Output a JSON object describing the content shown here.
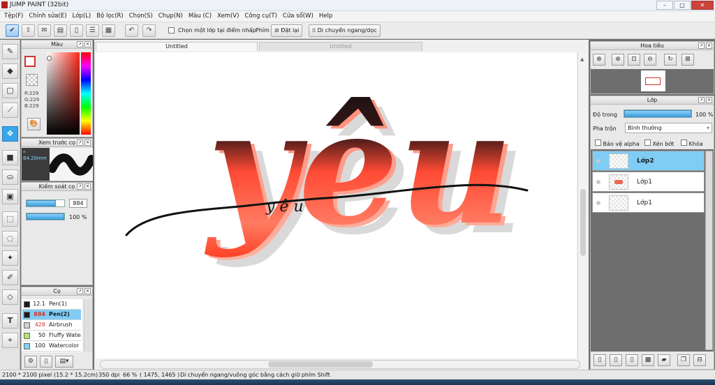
{
  "window": {
    "title": "JUMP PAINT (32bit)",
    "controls": [
      "–",
      "□",
      "✕"
    ]
  },
  "menu": [
    "Tệp(F)",
    "Chỉnh sửa(E)",
    "Lớp(L)",
    "Bộ lọc(R)",
    "Chọn(S)",
    "Chụp(N)",
    "Màu (C)",
    "Xem(V)",
    "Công cụ(T)",
    "Cửa sổ(W)",
    "Help"
  ],
  "toolbar": {
    "select_layer_label": "Chọn một lớp tại điểm nhấp",
    "keys_label": "Phím",
    "reset_label": "Đặt lại",
    "move_label": "Di chuyển ngang/dọc"
  },
  "color_panel": {
    "title": "Màu",
    "r": "R:229",
    "g": "G:229",
    "b": "B:229",
    "fg_color": "#ffffff",
    "accent": "#d0342c"
  },
  "preview_panel": {
    "title": "Xem trước cọ",
    "size": "* 64.20mm"
  },
  "brush_control": {
    "title": "Kiểm soát cọ",
    "size_value": "884",
    "opacity_value": "100 %",
    "size_fill": 0.78,
    "opacity_fill": 1.0
  },
  "brushes": {
    "title": "Cọ",
    "items": [
      {
        "size": "12.1",
        "name": "Pen(1)",
        "color": "#1a1a1a"
      },
      {
        "size": "884",
        "name": "Pen(2)",
        "color": "#1a1a1a"
      },
      {
        "size": "428",
        "name": "Airbrush",
        "color": "#d0d0d0"
      },
      {
        "size": "50",
        "name": "Fluffy Water",
        "color": "#b6e36e"
      },
      {
        "size": "100",
        "name": "Watercolor",
        "color": "#7fd4f5"
      }
    ]
  },
  "canvas": {
    "tabs": [
      "Untitled",
      "Untitled"
    ],
    "artwork": {
      "word": "yêu",
      "scribble": "y ê u"
    }
  },
  "navigator": {
    "title": "Hoa tiêu"
  },
  "layers": {
    "title": "Lớp",
    "opacity_label": "Độ trong",
    "opacity_value": "100 %",
    "opacity_fill": 1.0,
    "blend_label": "Pha trộn",
    "blend_value": "Bình thường",
    "protect_alpha": "Bảo vệ alpha",
    "clip": "Xén bớt",
    "lock": "Khóa",
    "items": [
      {
        "name": "Lớp2",
        "selected": true
      },
      {
        "name": "Lớp1",
        "selected": false
      },
      {
        "name": "Lớp1",
        "selected": false
      }
    ]
  },
  "status": {
    "size": "2100 * 2100 pixel",
    "dims": "(15.2 * 15.2cm)",
    "dpi": "350 dpi",
    "zoom": "66 %",
    "coords": "( 1475, 1465 )",
    "hint": "Di chuyển ngang/vuông góc bằng cách giữ phím Shift"
  }
}
